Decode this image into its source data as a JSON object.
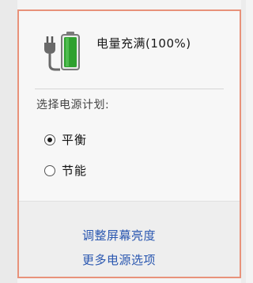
{
  "battery": {
    "status_text": "电量充满(100%)",
    "icon": "battery-plug-icon",
    "charge_percent": 100,
    "fill_color": "#2fa12f"
  },
  "power_plan": {
    "heading": "选择电源计划:",
    "options": [
      {
        "label": "平衡",
        "selected": true
      },
      {
        "label": "节能",
        "selected": false
      }
    ]
  },
  "links": {
    "brightness": "调整屏幕亮度",
    "more_options": "更多电源选项"
  },
  "colors": {
    "accent_border": "#e8927a",
    "link": "#2a57b0"
  }
}
